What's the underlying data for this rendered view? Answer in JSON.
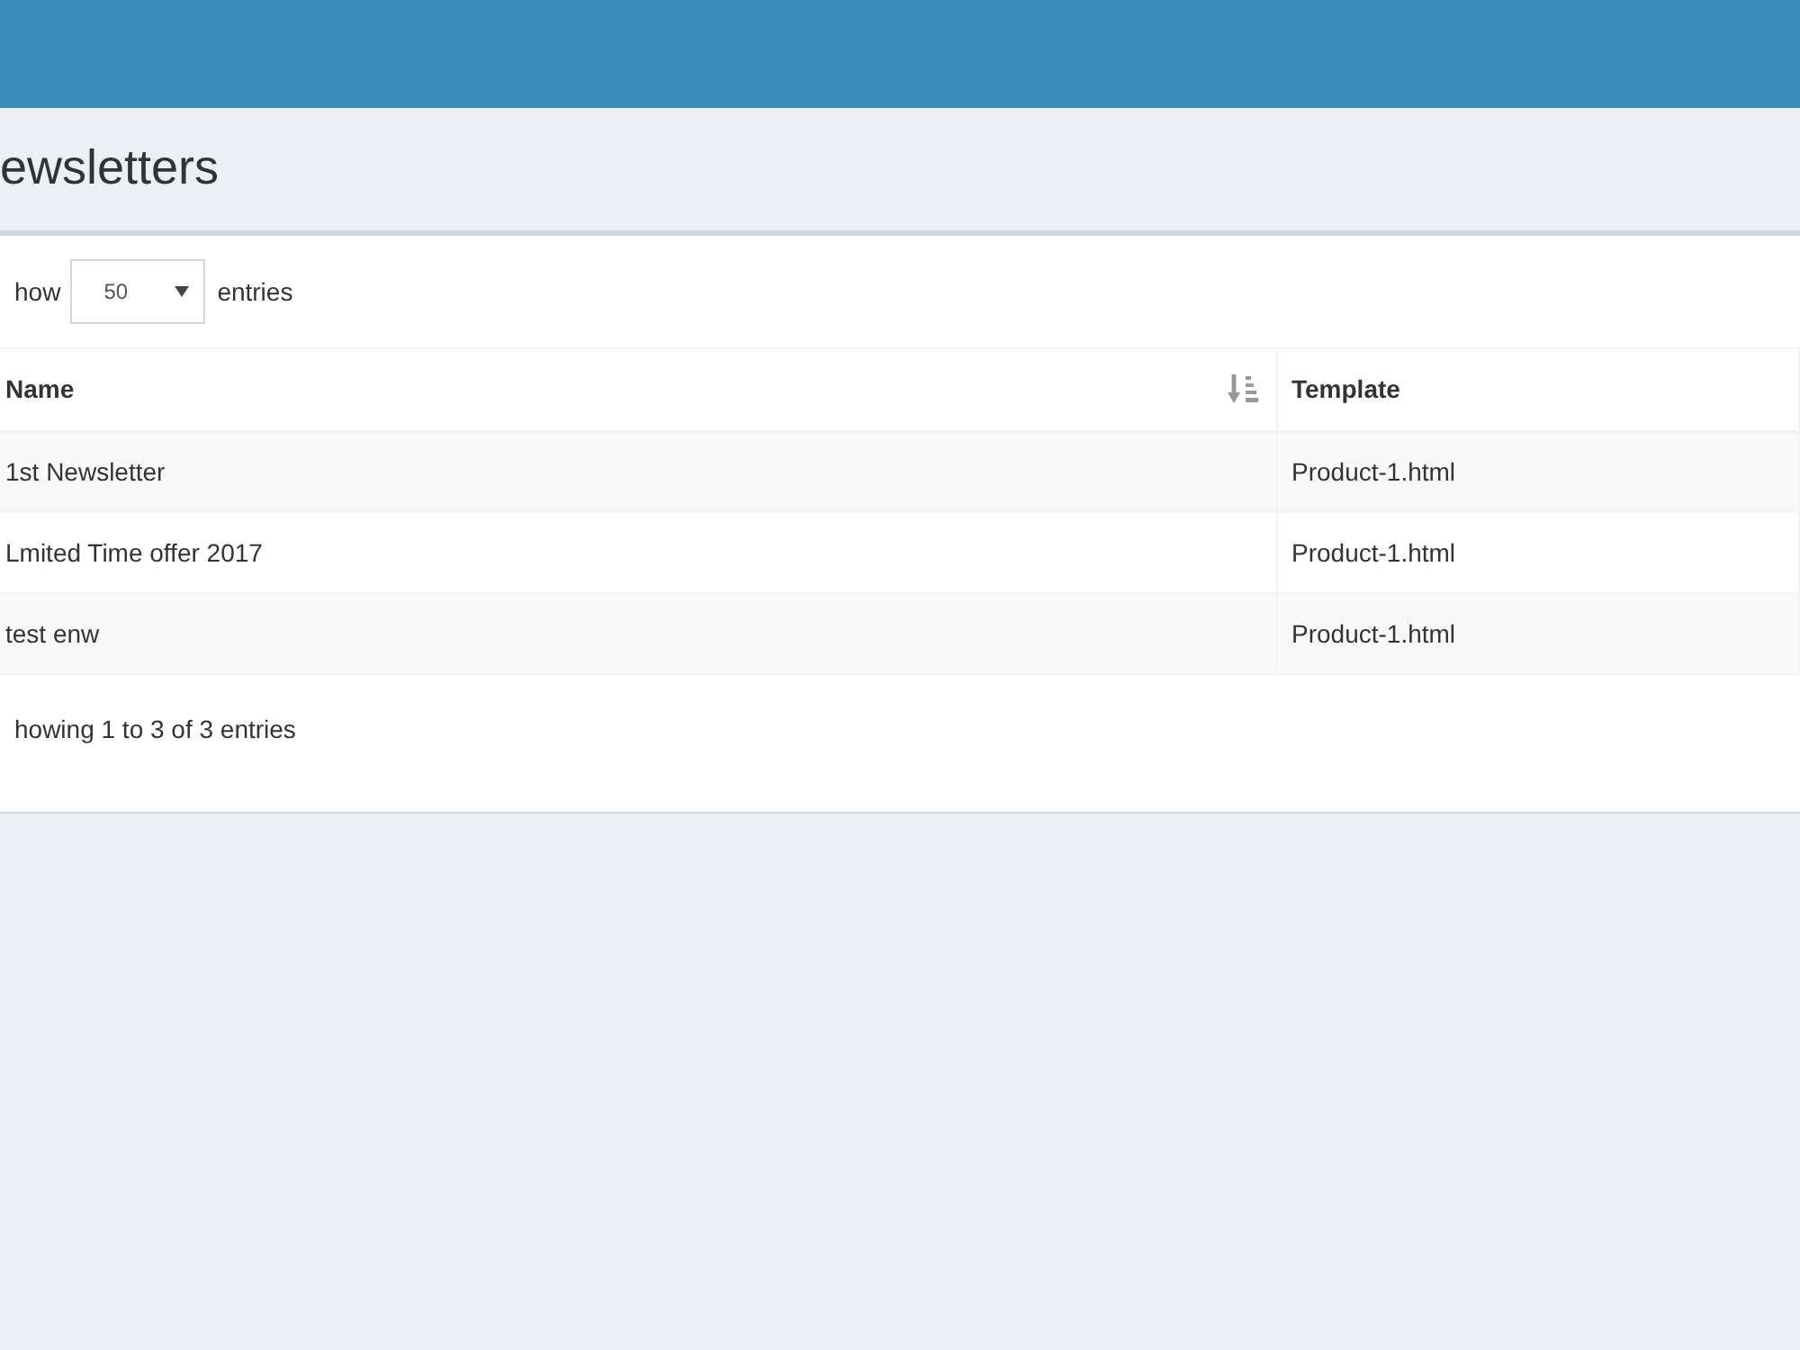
{
  "page": {
    "title": "ewsletters"
  },
  "length_menu": {
    "label_before": "how",
    "select": {
      "value": "50"
    },
    "label_after": "entries"
  },
  "table": {
    "columns": [
      {
        "label": "Name",
        "sortable": true
      },
      {
        "label": "Template",
        "sortable": false
      }
    ],
    "rows": [
      [
        "1st Newsletter",
        "Product-1.html"
      ],
      [
        "Lmited Time offer 2017",
        "Product-1.html"
      ],
      [
        "test enw",
        "Product-1.html"
      ]
    ]
  },
  "info": "howing 1 to 3 of 3 entries"
}
